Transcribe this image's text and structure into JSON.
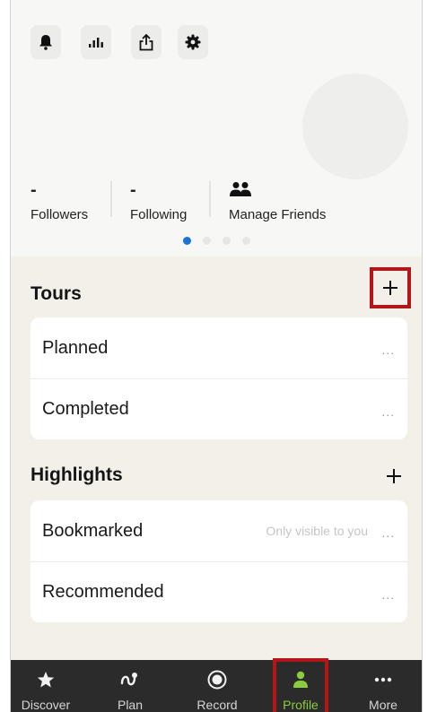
{
  "toolbar": {
    "icons": [
      "bell-icon",
      "stats-icon",
      "share-icon",
      "settings-icon"
    ]
  },
  "profile": {
    "followers": {
      "value": "-",
      "label": "Followers"
    },
    "following": {
      "value": "-",
      "label": "Following"
    },
    "manage_friends": {
      "label": "Manage Friends",
      "icon": "friends-icon"
    },
    "pager": {
      "pages": 4,
      "active": 1
    }
  },
  "tours": {
    "title": "Tours",
    "add_label": "+",
    "items": [
      {
        "label": "Planned",
        "more": "..."
      },
      {
        "label": "Completed",
        "more": "..."
      }
    ]
  },
  "highlights": {
    "title": "Highlights",
    "add_label": "+",
    "items": [
      {
        "label": "Bookmarked",
        "note": "Only visible to you",
        "more": "..."
      },
      {
        "label": "Recommended",
        "more": "..."
      }
    ]
  },
  "tabbar": {
    "tabs": [
      {
        "label": "Discover",
        "icon": "star-icon"
      },
      {
        "label": "Plan",
        "icon": "route-icon"
      },
      {
        "label": "Record",
        "icon": "record-icon"
      },
      {
        "label": "Profile",
        "icon": "person-icon",
        "active": true
      },
      {
        "label": "More",
        "icon": "more-dots-icon"
      }
    ]
  },
  "colors": {
    "accent_active": "#8ccc3f",
    "pager_active": "#1a73d9",
    "highlight_outline": "#b31616",
    "tabbar_bg": "#2b2b2b",
    "content_bg": "#f2f0e8"
  }
}
